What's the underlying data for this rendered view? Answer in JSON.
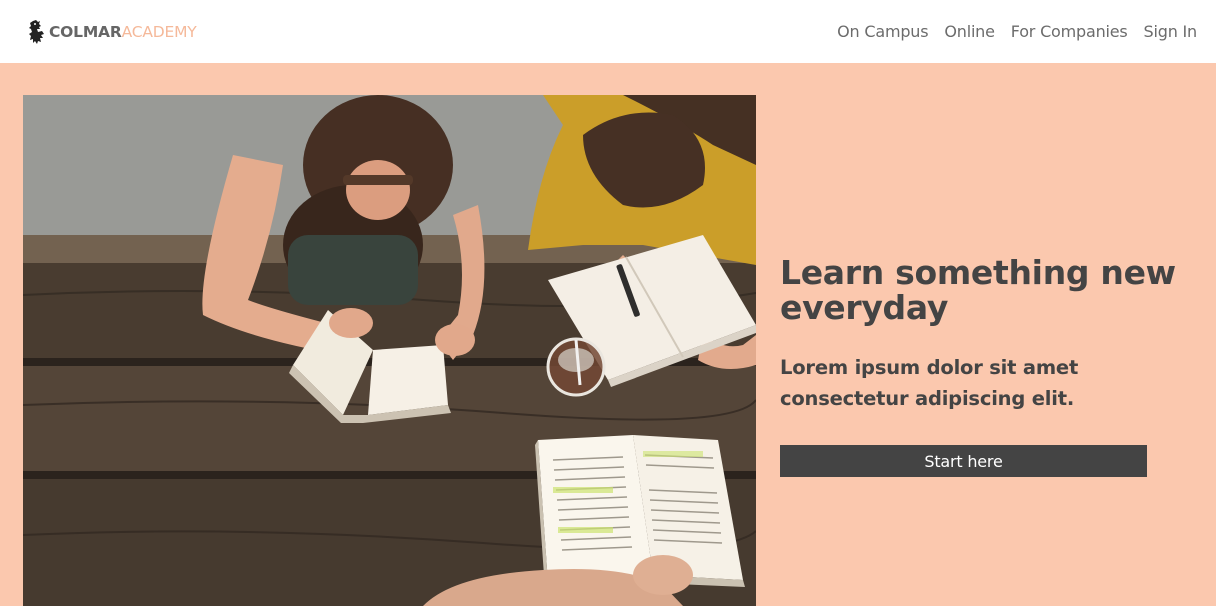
{
  "brand": {
    "name_bold": "COLMAR",
    "name_light": "ACADEMY",
    "icon": "lion-rampant-icon"
  },
  "nav": {
    "items": [
      {
        "label": "On Campus"
      },
      {
        "label": "Online"
      },
      {
        "label": "For Companies"
      },
      {
        "label": "Sign In"
      }
    ]
  },
  "hero": {
    "title": "Learn something new everyday",
    "subtitle": "Lorem ipsum dolor sit amet consectetur adipiscing elit.",
    "cta_label": "Start here",
    "image": "students-reading-at-picnic-table-photo"
  },
  "colors": {
    "hero_background": "#fbc8ae",
    "brand_accent": "#f5b99a",
    "text_dark": "#444444",
    "button_bg": "#444444",
    "button_text": "#ffffff"
  }
}
